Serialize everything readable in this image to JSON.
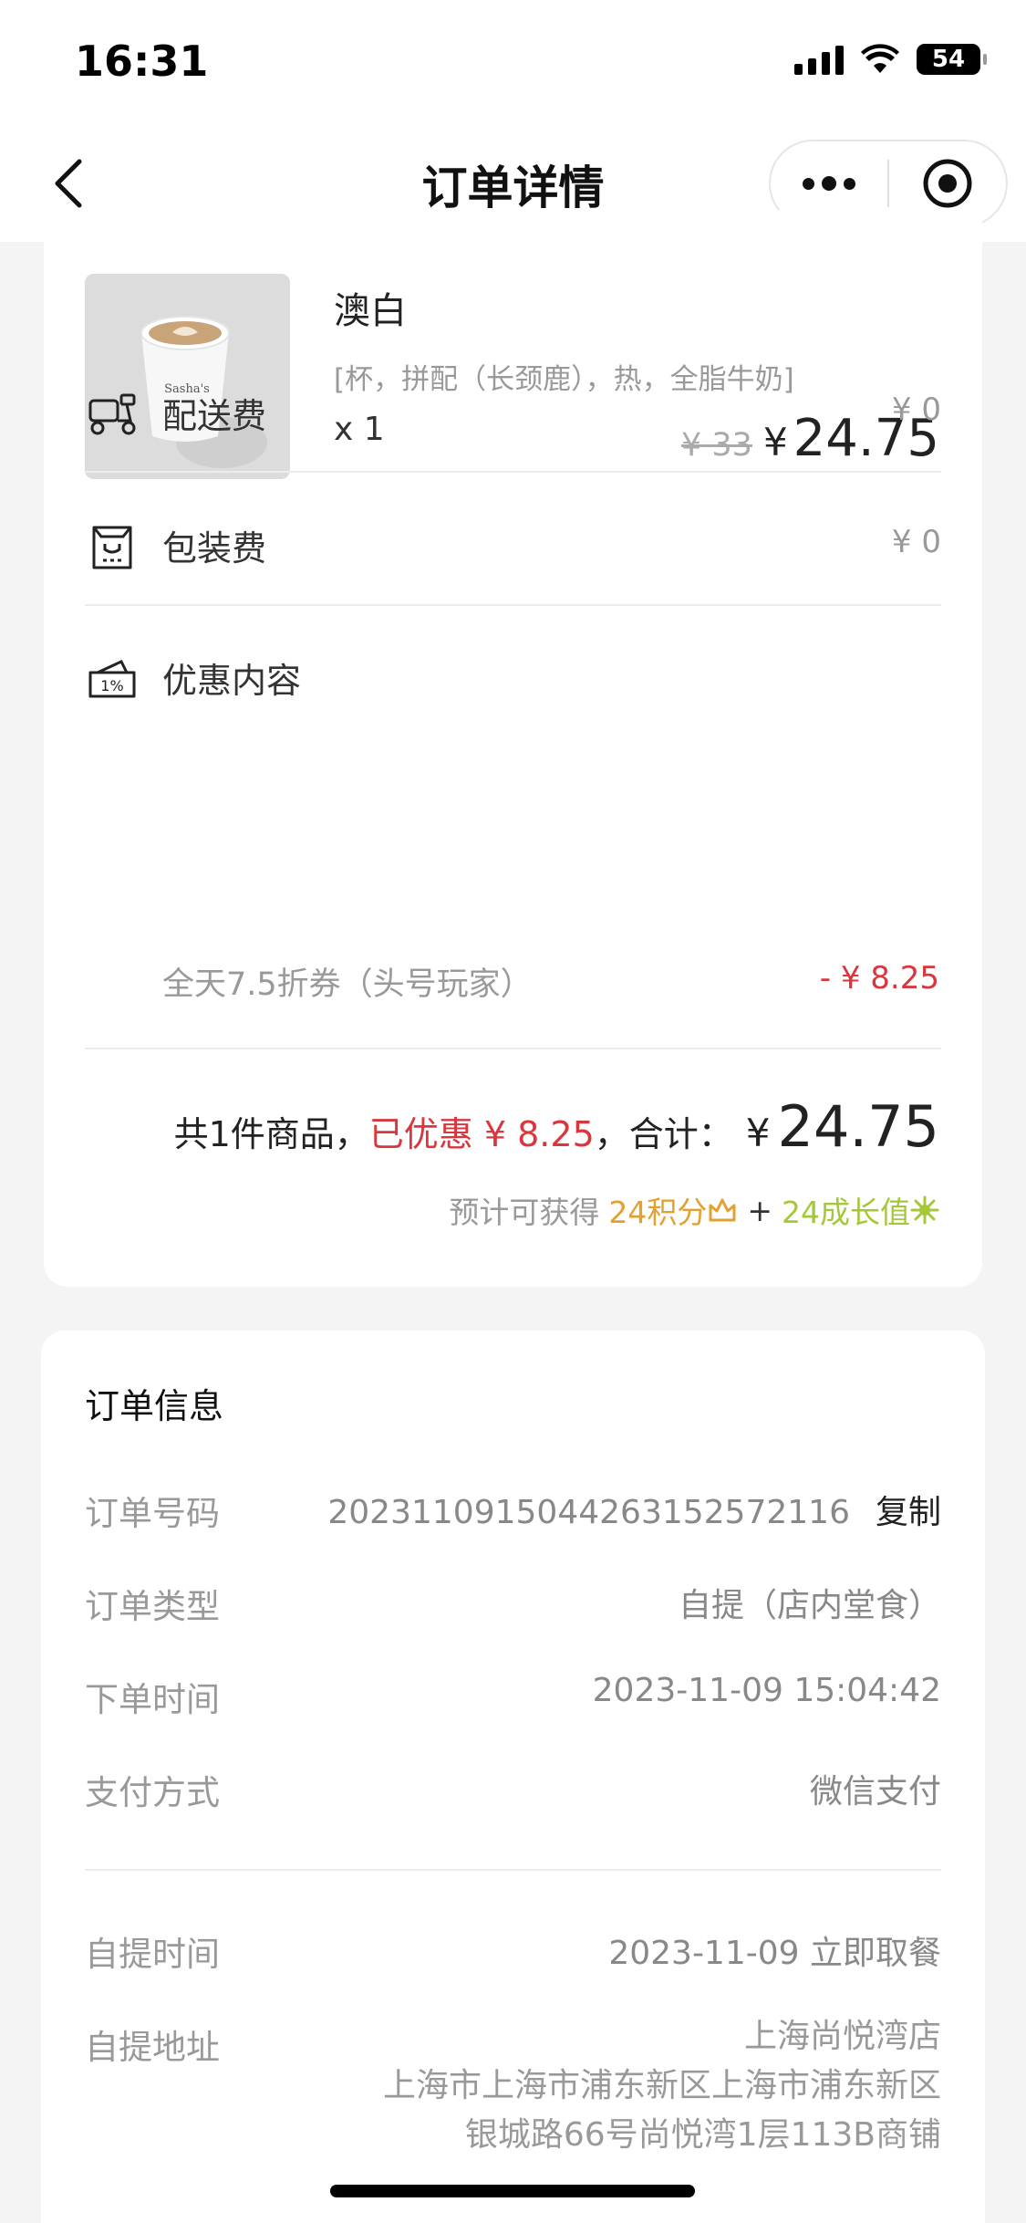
{
  "status_bar": {
    "time": "16:31",
    "battery": "54"
  },
  "nav": {
    "title": "订单详情"
  },
  "product": {
    "name": "澳白",
    "spec": "[杯，拼配（长颈鹿），热，全脂牛奶]",
    "quantity": "x 1",
    "original_price": "¥ 33",
    "price_symbol": "¥",
    "price": "24.75",
    "cup_logo": "Sasha's"
  },
  "fees": {
    "delivery_label": "配送费",
    "delivery_value": "¥ 0",
    "packaging_label": "包装费",
    "packaging_value": "¥ 0",
    "discount_label": "优惠内容",
    "discount_desc": "全天7.5折券（头号玩家）",
    "discount_value": "- ¥ 8.25"
  },
  "summary": {
    "count_text": "共1件商品，",
    "saved_text": "已优惠 ¥ 8.25",
    "total_label": "，合计：",
    "total_symbol": "¥",
    "total": "24.75",
    "reward_prefix": "预计可获得",
    "reward_points": "24积分",
    "reward_plus": "+",
    "reward_growth": "24成长值"
  },
  "order_info": {
    "title": "订单信息",
    "number_label": "订单号码",
    "number_value": "202311091504426315257211​6",
    "copy_label": "复制",
    "type_label": "订单类型",
    "type_value": "自提（店内堂食）",
    "time_label": "下单时间",
    "time_value": "2023-11-09 15:04:42",
    "payment_label": "支付方式",
    "payment_value": "微信支付",
    "pickup_time_label": "自提时间",
    "pickup_time_value": "2023-11-09 立即取餐",
    "pickup_addr_label": "自提地址",
    "pickup_addr_line1": "上海尚悦湾店",
    "pickup_addr_line2": "上海市上海市浦东新区上海市浦东新区",
    "pickup_addr_line3": "银城路66号尚悦湾1层113B商铺"
  },
  "colors": {
    "discount_red": "#d9363e",
    "points_orange": "#e2a131",
    "growth_green": "#a4c83a"
  }
}
